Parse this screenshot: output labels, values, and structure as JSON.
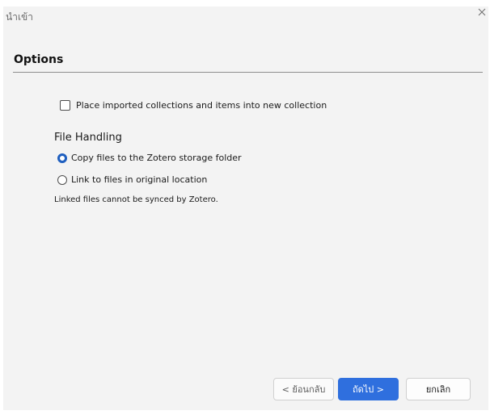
{
  "window": {
    "title": "นำเข้า"
  },
  "section": {
    "title": "Options"
  },
  "options": {
    "place_in_collection": {
      "label": "Place imported collections and items into new collection",
      "checked": false
    }
  },
  "file_handling": {
    "heading": "File Handling",
    "radios": [
      {
        "label": "Copy files to the Zotero storage folder",
        "selected": true
      },
      {
        "label": "Link to files in original location",
        "selected": false
      }
    ],
    "note": "Linked files cannot be synced by Zotero."
  },
  "buttons": {
    "back": "< ย้อนกลับ",
    "next": "ถัดไป >",
    "cancel": "ยกเลิก"
  },
  "colors": {
    "accent": "#2f6fde",
    "background": "#f3f3f3"
  },
  "icons": {
    "close": "close-icon"
  }
}
